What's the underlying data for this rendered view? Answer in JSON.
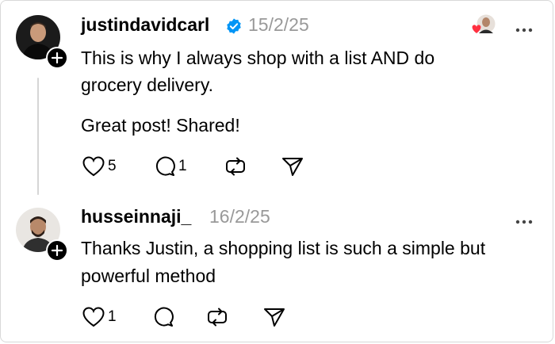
{
  "posts": [
    {
      "username": "justindavidcarl",
      "date": "15/2/25",
      "verified": true,
      "paragraphs": [
        "This is why I always shop with a list AND do",
        "grocery delivery.",
        "Great post! Shared!"
      ],
      "actions": {
        "likes": "5",
        "replies": "1"
      }
    },
    {
      "username": "husseinnaji_",
      "date": "16/2/25",
      "verified": false,
      "paragraphs": [
        "Thanks Justin, a shopping list is such a simple but",
        "powerful method"
      ],
      "actions": {
        "likes": "1"
      }
    }
  ],
  "icons": {
    "verified": "verified-badge-icon",
    "more": "more-options-icon",
    "like": "heart-icon",
    "reply": "comment-icon",
    "repost": "repost-icon",
    "share": "send-icon",
    "follow": "plus-icon"
  },
  "colors": {
    "verified": "#0095f6",
    "like_badge": "#ff3040",
    "muted": "#999999"
  }
}
